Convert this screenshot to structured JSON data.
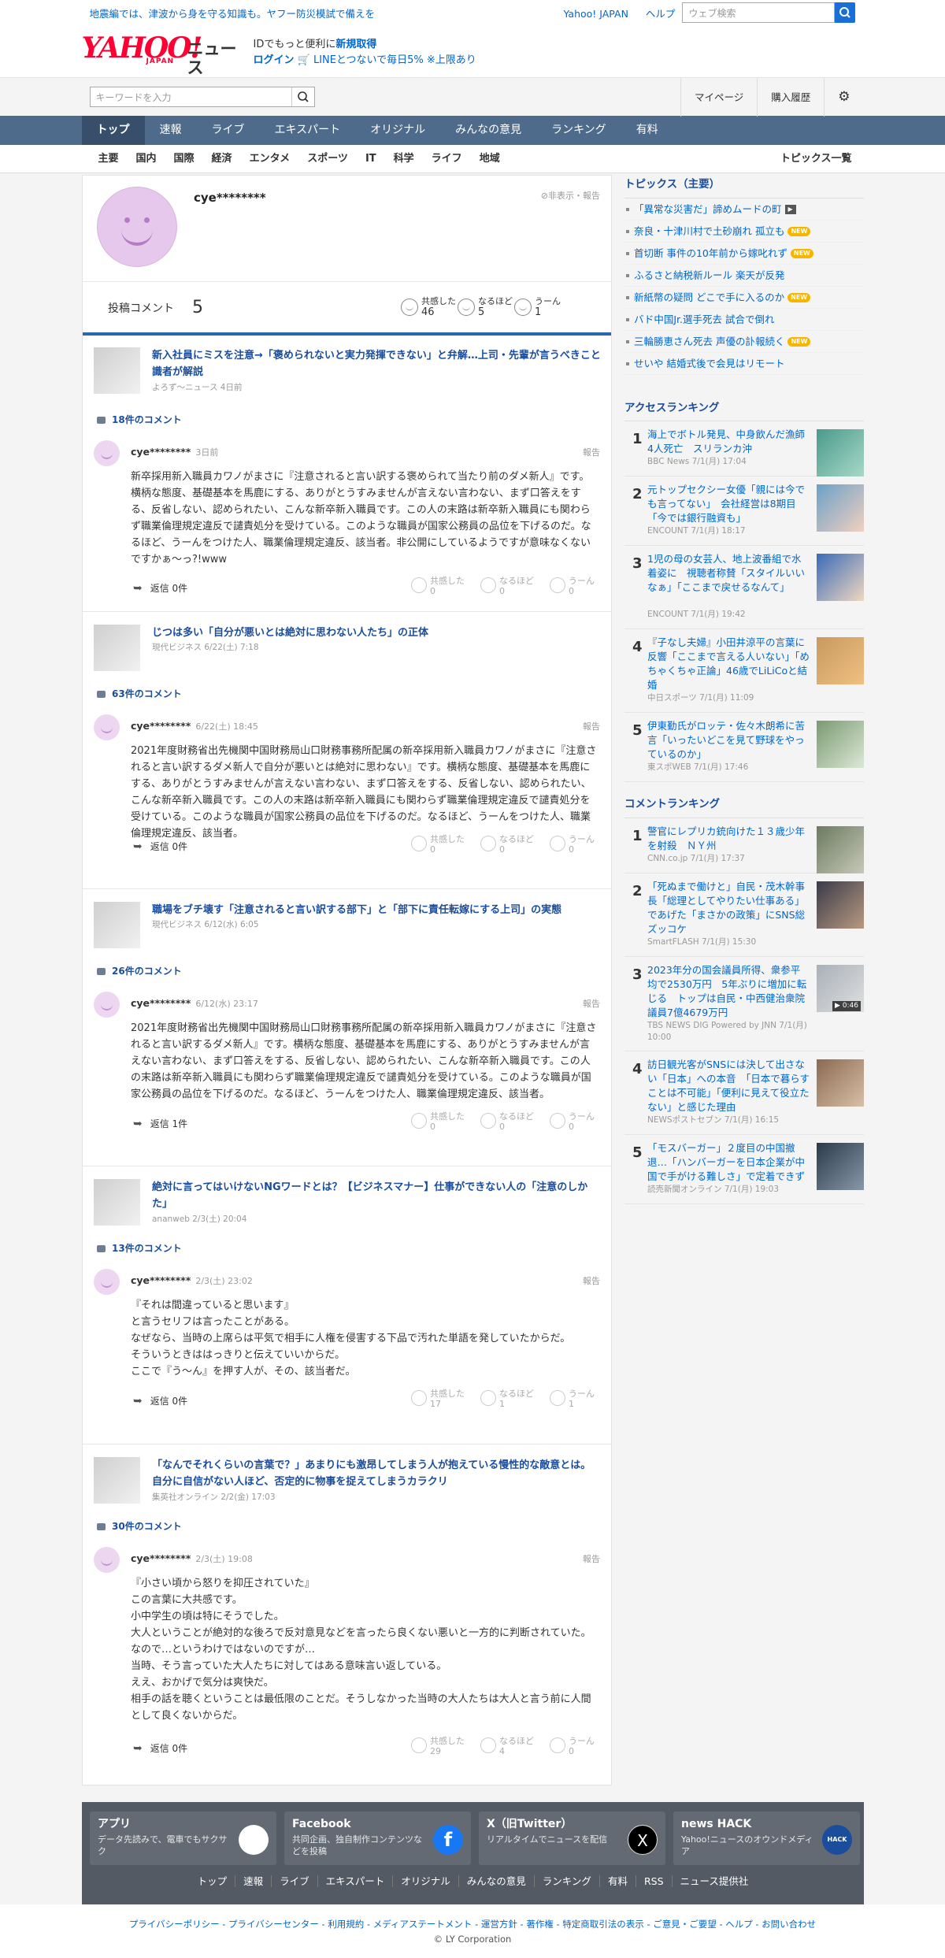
{
  "topbar": {
    "promo": "地震編では、津波から身を守る知識も。ヤフー防災模試で備えを",
    "links": [
      "Yahoo! JAPAN",
      "ヘルプ"
    ],
    "search_placeholder": "ウェブ検索"
  },
  "masthead": {
    "logo_text": "YAHOO!",
    "logo_sub": "JAPAN",
    "service": "ニュース",
    "id_line": "IDでもっと便利に",
    "signup": "新規取得",
    "login": "ログイン",
    "line_promo": "LINEとつないで毎日5% ※上限あり"
  },
  "search": {
    "placeholder": "キーワードを入力",
    "right_links": [
      "マイページ",
      "購入履歴"
    ]
  },
  "nav": {
    "items": [
      "トップ",
      "速報",
      "ライブ",
      "エキスパート",
      "オリジナル",
      "みんなの意見",
      "ランキング",
      "有料"
    ]
  },
  "subnav": {
    "items": [
      "主要",
      "国内",
      "国際",
      "経済",
      "エンタメ",
      "スポーツ",
      "IT",
      "科学",
      "ライフ",
      "地域"
    ],
    "topics_link": "トピックス一覧"
  },
  "profile": {
    "name": "cye********",
    "hide_report": "非表示・報告",
    "post_label": "投稿コメント",
    "post_count": "5",
    "reactions": [
      {
        "label": "共感した",
        "count": "46"
      },
      {
        "label": "なるほど",
        "count": "5"
      },
      {
        "label": "うーん",
        "count": "1"
      }
    ]
  },
  "articles": [
    {
      "title": "新入社員にミスを注意→「褒められないと実力発揮できない」と弁解…上司・先輩が言うべきこと　識者が解説",
      "source": "よろず〜ニュース 4日前",
      "comment_count": "18件のコメント",
      "user": "cye********",
      "date": "3日前",
      "report": "報告",
      "body": "新卒採用新入職員カワノがまさに『注意されると言い訳する褒められて当たり前のダメ新人』です。横柄な態度、基礎基本を馬鹿にする、ありがとうすみませんが言えない言わない、まず口答えをする、反省しない、認められたい、こんな新卒新入職員です。この人の末路は新卒新入職員にも関わらず職業倫理規定違反で譴責処分を受けている。このような職員が国家公務員の品位を下げるのだ。なるほど、うーんをつけた人、職業倫理規定違反、該当者。非公開にしているようですが意味なくないですかぁ〜っ?!www",
      "reply": "返信 0件",
      "reactions": [
        {
          "label": "共感した",
          "count": "0"
        },
        {
          "label": "なるほど",
          "count": "0"
        },
        {
          "label": "うーん",
          "count": "0"
        }
      ]
    },
    {
      "title": "じつは多い「自分が悪いとは絶対に思わない人たち」の正体",
      "source": "現代ビジネス 6/22(土) 7:18",
      "comment_count": "63件のコメント",
      "user": "cye********",
      "date": "6/22(土) 18:45",
      "report": "報告",
      "body": "2021年度財務省出先機関中国財務局山口財務事務所配属の新卒採用新入職員カワノがまさに『注意されると言い訳するダメ新人で自分が悪いとは絶対に思わない』です。横柄な態度、基礎基本を馬鹿にする、ありがとうすみませんが言えない言わない、まず口答えをする、反省しない、認められたい、こんな新卒新入職員です。この人の末路は新卒新入職員にも関わらず職業倫理規定違反で譴責処分を受けている。このような職員が国家公務員の品位を下げるのだ。なるほど、うーんをつけた人、職業倫理規定違反、該当者。",
      "reply": "返信 0件",
      "reactions": [
        {
          "label": "共感した",
          "count": "0"
        },
        {
          "label": "なるほど",
          "count": "0"
        },
        {
          "label": "うーん",
          "count": "0"
        }
      ]
    },
    {
      "title": "職場をブチ壊す「注意されると言い訳する部下」と「部下に責任転嫁にする上司」の実態",
      "source": "現代ビジネス 6/12(水) 6:05",
      "comment_count": "26件のコメント",
      "user": "cye********",
      "date": "6/12(水) 23:17",
      "report": "報告",
      "body": "2021年度財務省出先機関中国財務局山口財務事務所配属の新卒採用新入職員カワノがまさに『注意されると言い訳するダメ新人』です。横柄な態度、基礎基本を馬鹿にする、ありがとうすみませんが言えない言わない、まず口答えをする、反省しない、認められたい、こんな新卒新入職員です。この人の末路は新卒新入職員にも関わらず職業倫理規定違反で譴責処分を受けている。このような職員が国家公務員の品位を下げるのだ。なるほど、うーんをつけた人、職業倫理規定違反、該当者。",
      "reply": "返信 1件",
      "reactions": [
        {
          "label": "共感した",
          "count": "0"
        },
        {
          "label": "なるほど",
          "count": "0"
        },
        {
          "label": "うーん",
          "count": "0"
        }
      ]
    },
    {
      "title": "絶対に言ってはいけないNGワードとは？【ビジネスマナー】仕事ができない人の「注意のしかた」",
      "source": "ananweb 2/3(土) 20:04",
      "comment_count": "13件のコメント",
      "user": "cye********",
      "date": "2/3(土) 23:02",
      "report": "報告",
      "body": "『それは間違っていると思います』\nと言うセリフは言ったことがある。\nなぜなら、当時の上席らは平気で相手に人権を侵害する下品で汚れた単語を発していたからだ。\nそういうときははっきりと伝えていいからだ。\nここで『う〜ん』を押す人が、その、該当者だ。",
      "reply": "返信 0件",
      "reactions": [
        {
          "label": "共感した",
          "count": "17"
        },
        {
          "label": "なるほど",
          "count": "1"
        },
        {
          "label": "うーん",
          "count": "1"
        }
      ]
    },
    {
      "title": "「なんでそれくらいの言葉で？」あまりにも激昂してしまう人が抱えている慢性的な敵意とは。自分に自信がない人ほど、否定的に物事を捉えてしまうカラクリ",
      "source": "集英社オンライン 2/2(金) 17:03",
      "comment_count": "30件のコメント",
      "user": "cye********",
      "date": "2/3(土) 19:08",
      "report": "報告",
      "body": "『小さい頃から怒りを抑圧されていた』\nこの言葉に大共感です。\n小中学生の頃は特にそうでした。\n大人ということが絶対的な後ろで反対意見などを言ったら良くない悪いと一方的に判断されていた。\nなので…というわけではないのですが…\n当時、そう言っていた大人たちに対してはある意味言い返している。\nええ、おかげで気分は爽快だ。\n相手の話を聴くということは最低限のことだ。そうしなかった当時の大人たちは大人と言う前に人間として良くないからだ。",
      "reply": "返信 0件",
      "reactions": [
        {
          "label": "共感した",
          "count": "29"
        },
        {
          "label": "なるほど",
          "count": "4"
        },
        {
          "label": "うーん",
          "count": "0"
        }
      ]
    }
  ],
  "topics": {
    "heading": "トピックス（主要）",
    "items": [
      {
        "text": "「異常な災害だ」諦めムードの町",
        "badge": "▶"
      },
      {
        "text": "奈良・十津川村で土砂崩れ 孤立も",
        "badge": "NEW"
      },
      {
        "text": "首切断 事件の10年前から嫁叱れず",
        "badge": "NEW"
      },
      {
        "text": "ふるさと納税新ルール 楽天が反発",
        "badge": ""
      },
      {
        "text": "新紙幣の疑問 どこで手に入るのか",
        "badge": "NEW"
      },
      {
        "text": "バド中国Jr.選手死去 試合で倒れ",
        "badge": ""
      },
      {
        "text": "三輪勝恵さん死去 声優の訃報続く",
        "badge": "NEW"
      },
      {
        "text": "せいや 結婚式後で会見はリモート",
        "badge": ""
      }
    ]
  },
  "access_ranking": {
    "heading": "アクセスランキング",
    "items": [
      {
        "rank": "1",
        "title": "海上でボトル発見、中身飲んだ漁師4人死亡　スリランカ沖",
        "meta": "BBC News 7/1(月) 17:04"
      },
      {
        "rank": "2",
        "title": "元トップセクシー女優「親には今でも言ってない」　会社経営は8期目「今では銀行融資も」",
        "meta": "ENCOUNT 7/1(月) 18:17"
      },
      {
        "rank": "3",
        "title": "1児の母の女芸人、地上波番組で水着姿に　視聴者称賛「スタイルいいなぁ」「ここまで戻せるなんて」",
        "meta": "ENCOUNT 7/1(月) 19:42"
      },
      {
        "rank": "4",
        "title": "『子なし夫婦』小田井涼平の言葉に反響「ここまで言える人いない」「めちゃくちゃ正論」46歳でLiLiCoと結婚",
        "meta": "中日スポーツ 7/1(月) 11:09"
      },
      {
        "rank": "5",
        "title": "伊東勤氏がロッテ・佐々木朗希に苦言「いったいどこを見て野球をやっているのか」",
        "meta": "東スポWEB 7/1(月) 17:46"
      }
    ]
  },
  "comment_ranking": {
    "heading": "コメントランキング",
    "items": [
      {
        "rank": "1",
        "title": "警官にレプリカ銃向けた１３歳少年を射殺　ＮＹ州",
        "meta": "CNN.co.jp 7/1(月) 17:37",
        "duration": ""
      },
      {
        "rank": "2",
        "title": "「死ぬまで働けと」自民・茂木幹事長「総理としてやりたい仕事ある」であげた「まさかの政策」にSNS総ズッコケ",
        "meta": "SmartFLASH 7/1(月) 15:30",
        "duration": ""
      },
      {
        "rank": "3",
        "title": "2023年分の国会議員所得、衆参平均で2530万円　5年ぶりに増加に転じる　トップは自民・中西健治衆院議員7億4679万円",
        "meta": "TBS NEWS DIG Powered by JNN 7/1(月) 10:00",
        "duration": "▶ 0:46"
      },
      {
        "rank": "4",
        "title": "訪日観光客がSNSには決して出さない「日本」への本音　「日本で暮らすことは不可能」「便利に見えて役立たない」と感じた理由",
        "meta": "NEWSポストセブン 7/1(月) 16:15",
        "duration": ""
      },
      {
        "rank": "5",
        "title": "「モスバーガー」２度目の中国撤退…「ハンバーガーを日本企業が中国で手がける難しさ」で定着できず",
        "meta": "読売新聞オンライン 7/1(月) 19:03",
        "duration": ""
      }
    ]
  },
  "footer": {
    "apps": [
      {
        "title": "アプリ",
        "desc": "データ先読みで、電車でもサクサク",
        "color": "#ffffff"
      },
      {
        "title": "Facebook",
        "desc": "共同企画、独自制作コンテンツなどを投稿",
        "color": "#1877f2"
      },
      {
        "title": "X（旧Twitter）",
        "desc": "リアルタイムでニュースを配信",
        "color": "#000000"
      },
      {
        "title": "news HACK",
        "desc": "Yahoo!ニュースのオウンドメディア",
        "color": "#1a4d9c"
      }
    ],
    "links": [
      "トップ",
      "速報",
      "ライブ",
      "エキスパート",
      "オリジナル",
      "みんなの意見",
      "ランキング",
      "有料",
      "RSS",
      "ニュース提供社"
    ],
    "legal": "プライバシーポリシー - プライバシーセンター - 利用規約 - メディアステートメント - 運営方針 - 著作権 - 特定商取引法の表示 - ご意見・ご要望 - ヘルプ - お問い合わせ",
    "copyright": "© LY Corporation"
  }
}
